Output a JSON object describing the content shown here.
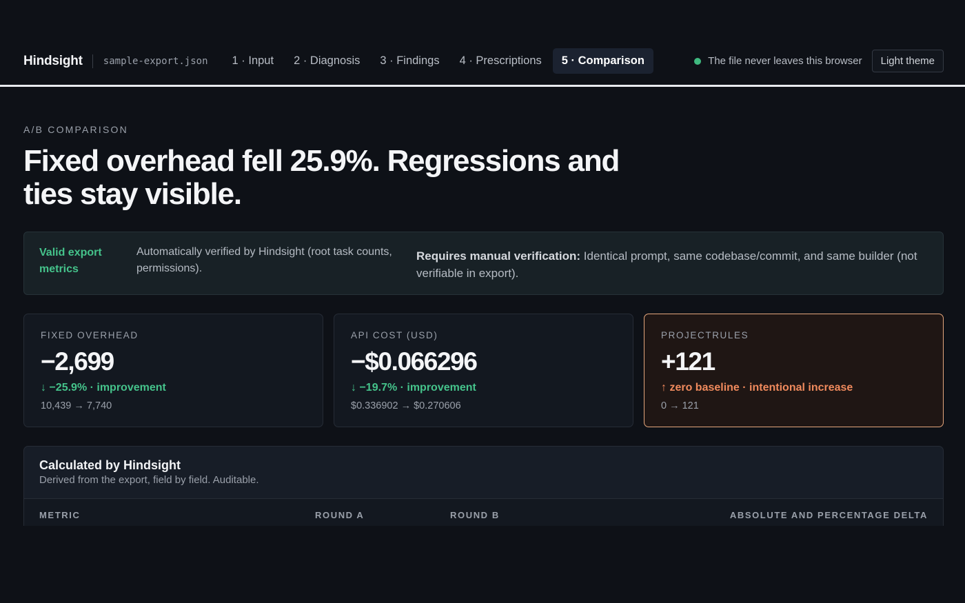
{
  "header": {
    "brand": "Hindsight",
    "filename": "sample-export.json",
    "nav": [
      {
        "label": "1 · Input"
      },
      {
        "label": "2 · Diagnosis"
      },
      {
        "label": "3 · Findings"
      },
      {
        "label": "4 · Prescriptions"
      },
      {
        "label": "5 · Comparison",
        "active": true
      }
    ],
    "privacy_note": "The file never leaves this browser",
    "theme_button": "Light theme"
  },
  "page": {
    "eyebrow": "A/B COMPARISON",
    "headline": "Fixed overhead fell 25.9%. Regressions and ties stay visible."
  },
  "banner": {
    "label": "Valid export metrics",
    "auto_text": "Automatically verified by Hindsight (root task counts, permissions).",
    "manual_heading": "Requires manual verification:",
    "manual_text": " Identical prompt, same codebase/commit, and same builder (not verifiable in export)."
  },
  "cards": [
    {
      "label": "FIXED OVERHEAD",
      "value": "−2,699",
      "arrow": "↓",
      "delta": "−25.9% · improvement",
      "range": "10,439 → 7,740",
      "status": "improvement"
    },
    {
      "label": "API COST (USD)",
      "value": "−$0.066296",
      "arrow": "↓",
      "delta": "−19.7% · improvement",
      "range": "$0.336902 → $0.270606",
      "status": "improvement"
    },
    {
      "label": "PROJECTRULES",
      "value": "+121",
      "arrow": "↑",
      "delta": "zero baseline · intentional increase",
      "range": "0 → 121",
      "status": "intentional-increase"
    }
  ],
  "table": {
    "title": "Calculated by Hindsight",
    "subtitle": "Derived from the export, field by field. Auditable.",
    "columns": [
      "METRIC",
      "ROUND A",
      "ROUND B",
      "ABSOLUTE AND PERCENTAGE DELTA"
    ]
  },
  "colors": {
    "background": "#0e1117",
    "accent_green": "#45c38b",
    "warning_orange": "#f08a5d",
    "warning_border": "#e6a77d"
  }
}
